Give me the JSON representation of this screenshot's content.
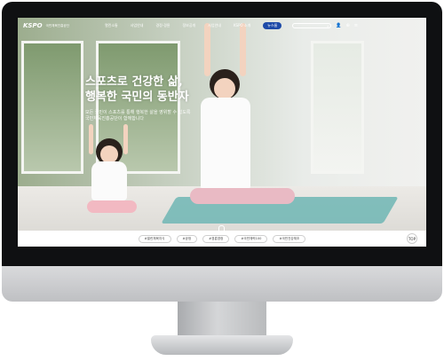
{
  "header": {
    "logo": "KSPO",
    "logo_sub": "국민체육진흥공단",
    "nav": [
      "열린소통",
      "사업안내",
      "경정·경륜",
      "정보공개",
      "사업안내",
      "KSPO 소개"
    ],
    "news_label": "뉴스룸",
    "search_icon": "⌕",
    "user_icon": "👤",
    "globe_icon": "⊕",
    "menu_icon": "≡"
  },
  "hero": {
    "headline_line1": "스포츠로 건강한 삶,",
    "headline_line2": "행복한 국민의 동반자",
    "subtext": "모든 국민이 스포츠를 통해 행복한 삶을 영위할 수 있도록 국민체육진흥공단이 함께합니다"
  },
  "bottom_links": [
    "#열린체육지식",
    "#공정",
    "#경륜경정",
    "#국민체력100",
    "#국민건강체조"
  ],
  "top_button": "TOP"
}
